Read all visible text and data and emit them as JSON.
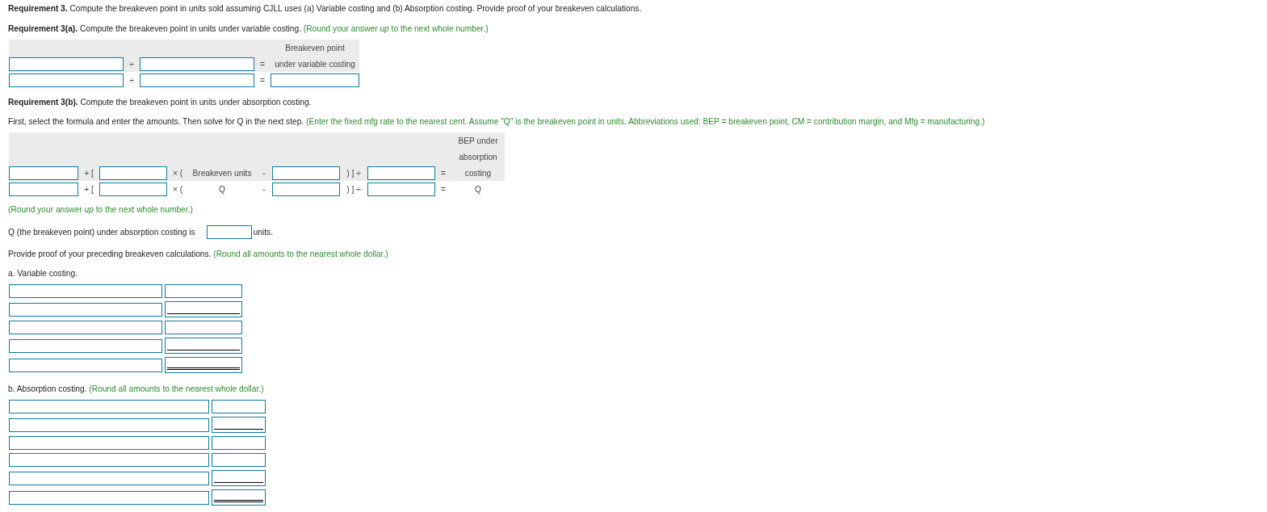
{
  "requirement_3": {
    "text": "**Requirement 3.** Compute the breakeven point in units sold assuming CJLL uses (a) Variable costing and (b) Absorption costing. Provide proof of your breakeven calculations."
  },
  "requirement_3a": {
    "text": "**Requirement 3(a).** Compute the breakeven point in units under variable costing.",
    "hint": "(Round your answer *up* to the next whole number.)"
  },
  "variable_formula": {
    "header_lines": [
      "Breakeven point"
    ],
    "rows": [
      {
        "cells": [
          {
            "kind": "input"
          },
          {
            "kind": "operator",
            "text": "÷"
          },
          {
            "kind": "input"
          },
          {
            "kind": "operator",
            "text": "="
          },
          {
            "kind": "label",
            "text": "under variable costing"
          }
        ]
      },
      {
        "cells": [
          {
            "kind": "input"
          },
          {
            "kind": "operator",
            "text": "÷"
          },
          {
            "kind": "input"
          },
          {
            "kind": "operator",
            "text": "="
          },
          {
            "kind": "input"
          }
        ]
      }
    ]
  },
  "requirement_3b": {
    "text": "**Requirement 3(b).** Compute the breakeven point in units under absorption costing."
  },
  "instructions": {
    "text": "First, select the formula and enter the amounts. Then solve for Q in the next step.",
    "hint": "(Enter the fixed mfg rate to the nearest cent. Assume \"Q\" is the breakeven point in units. Abbreviations used: BEP = breakeven point, CM = contribution margin, and Mfg = manufacturing.)"
  },
  "absorption_formula": {
    "header_lines": [
      "BEP under",
      "absorption"
    ],
    "rows": [
      {
        "cells": [
          {
            "kind": "input"
          },
          {
            "kind": "operator",
            "text": "+ ["
          },
          {
            "kind": "input"
          },
          {
            "kind": "operator",
            "text": "× ("
          },
          {
            "kind": "label",
            "text": "Breakeven units"
          },
          {
            "kind": "operator",
            "text": "-"
          },
          {
            "kind": "input"
          },
          {
            "kind": "operator",
            "text": ") ] ÷"
          },
          {
            "kind": "input"
          },
          {
            "kind": "operator",
            "text": "="
          },
          {
            "kind": "label",
            "text": "costing"
          }
        ]
      },
      {
        "cells": [
          {
            "kind": "input"
          },
          {
            "kind": "operator",
            "text": "+ ["
          },
          {
            "kind": "input"
          },
          {
            "kind": "operator",
            "text": "× ("
          },
          {
            "kind": "label",
            "text": "Q"
          },
          {
            "kind": "operator",
            "text": "-"
          },
          {
            "kind": "input"
          },
          {
            "kind": "operator",
            "text": ") ] ÷"
          },
          {
            "kind": "input"
          },
          {
            "kind": "operator",
            "text": "="
          },
          {
            "kind": "label",
            "text": "Q"
          }
        ]
      }
    ]
  },
  "rounding_hint": "(Round your answer *up* to the next whole number.)",
  "q_answer": {
    "label": "Q (the breakeven point) under absorption costing is",
    "unit": "units."
  },
  "proof": {
    "text": "Provide proof of your preceding breakeven calculations.",
    "hint": "(Round all amounts to the nearest whole dollar.)"
  },
  "variable_proof": {
    "title": "a. Variable costing.",
    "rows": [
      {
        "kind": "plain"
      },
      {
        "kind": "subtotal"
      },
      {
        "kind": "plain"
      },
      {
        "kind": "subtotal"
      },
      {
        "kind": "total"
      }
    ]
  },
  "absorption_proof": {
    "title": "b. Absorption costing.",
    "hint": "(Round all amounts to the nearest whole dollar.)",
    "rows": [
      {
        "kind": "plain"
      },
      {
        "kind": "subtotal"
      },
      {
        "kind": "plain"
      },
      {
        "kind": "plain"
      },
      {
        "kind": "subtotal"
      },
      {
        "kind": "total"
      }
    ]
  }
}
